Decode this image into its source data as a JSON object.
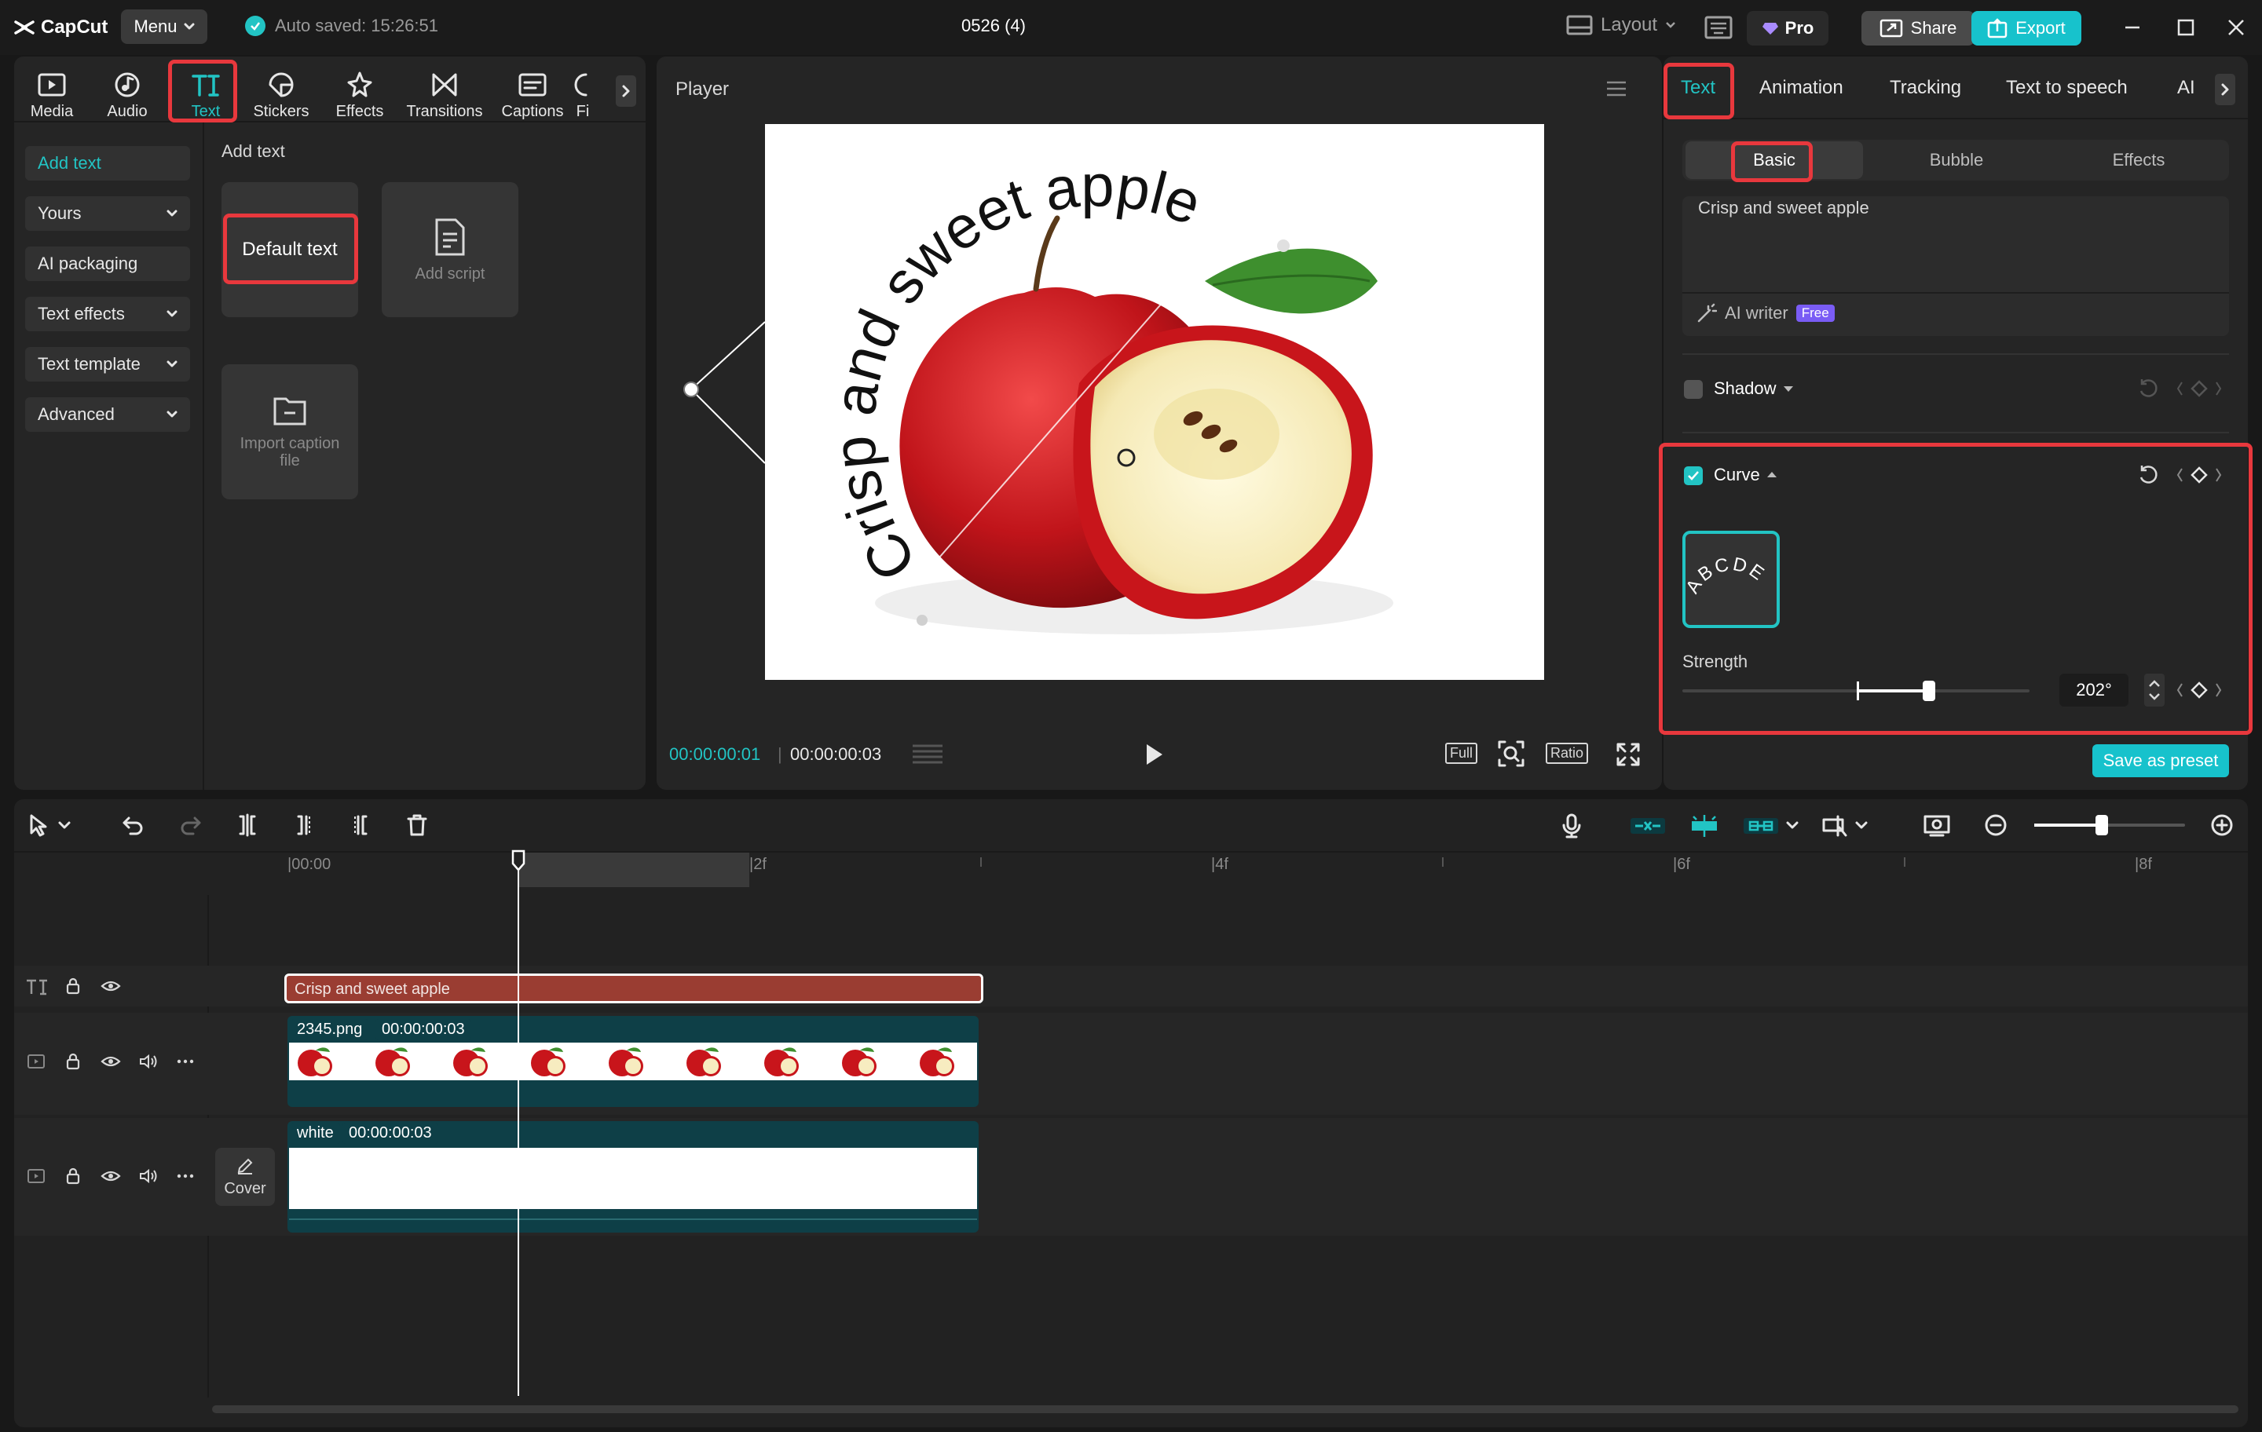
{
  "app": {
    "logo": "CapCut",
    "menu_label": "Menu",
    "autosave": "Auto saved: 15:26:51",
    "project_title": "0526 (4)"
  },
  "topbar": {
    "layout_label": "Layout",
    "pro_label": "Pro",
    "share_label": "Share",
    "export_label": "Export"
  },
  "toolbar": {
    "tools": [
      {
        "label": "Media",
        "icon": "media-icon"
      },
      {
        "label": "Audio",
        "icon": "audio-icon"
      },
      {
        "label": "Text",
        "icon": "text-icon",
        "active": true
      },
      {
        "label": "Stickers",
        "icon": "sticker-icon"
      },
      {
        "label": "Effects",
        "icon": "effects-icon"
      },
      {
        "label": "Transitions",
        "icon": "transitions-icon"
      },
      {
        "label": "Captions",
        "icon": "captions-icon"
      },
      {
        "label": "Fi",
        "icon": "filters-icon"
      }
    ]
  },
  "sidebar": {
    "items": [
      {
        "label": "Add text"
      },
      {
        "label": "Yours"
      },
      {
        "label": "AI packaging"
      },
      {
        "label": "Text effects"
      },
      {
        "label": "Text template"
      },
      {
        "label": "Advanced"
      }
    ]
  },
  "content": {
    "heading": "Add text",
    "default_text": "Default text",
    "add_script": "Add script",
    "import_caption": "Import caption file"
  },
  "player": {
    "title": "Player",
    "overlay_text": "Crisp and sweet apple",
    "current_time": "00:00:00:01",
    "total_time": "00:00:00:03",
    "full_label": "Full",
    "ratio_label": "Ratio"
  },
  "inspector": {
    "tabs": [
      "Text",
      "Animation",
      "Tracking",
      "Text to speech",
      "AI"
    ],
    "subtabs": [
      "Basic",
      "Bubble",
      "Effects"
    ],
    "text_value": "Crisp and sweet apple",
    "ai_writer": "AI writer",
    "free_badge": "Free",
    "shadow_label": "Shadow",
    "curve_label": "Curve",
    "curve_preview": "ABCDE",
    "strength_label": "Strength",
    "strength_value": "202°",
    "strength_level": 0.71,
    "save_preset": "Save as preset"
  },
  "timeline": {
    "ruler": [
      "00:00",
      "2f",
      "4f",
      "6f",
      "8f"
    ],
    "text_clip": "Crisp and sweet apple",
    "video_clip": {
      "name": "2345.png",
      "duration": "00:00:00:03"
    },
    "bg_clip": {
      "name": "white",
      "duration": "00:00:00:03"
    },
    "cover_label": "Cover",
    "zoom_level": 0.45
  },
  "colors": {
    "accent": "#22c4c4",
    "highlight": "#e8383d",
    "text_clip": "#9a3d32",
    "media_clip": "#0e3f47"
  }
}
